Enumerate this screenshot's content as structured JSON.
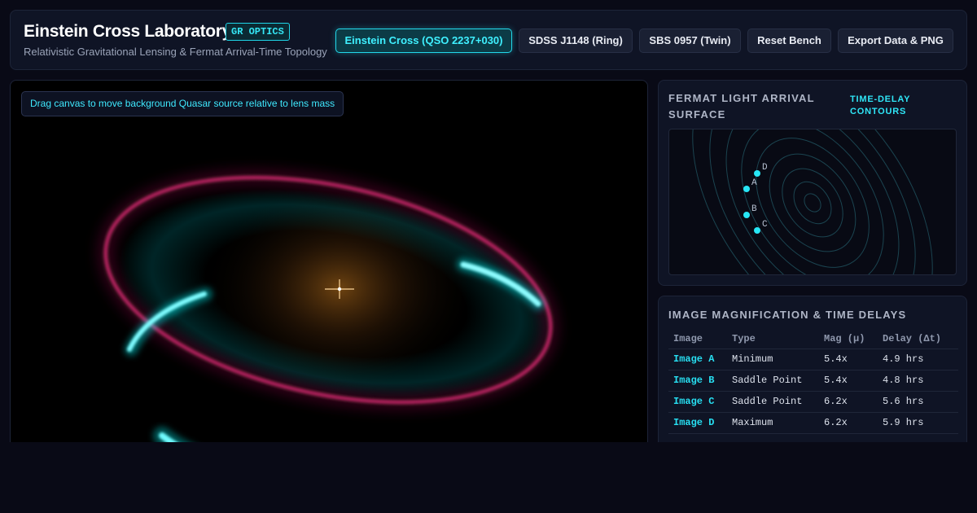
{
  "header": {
    "title": "Einstein Cross Laboratory",
    "badge": "GR OPTICS",
    "subtitle": "Relativistic Gravitational Lensing & Fermat Arrival-Time Topology"
  },
  "toolbar": {
    "buttons": [
      {
        "label": "Einstein Cross (QSO 2237+030)",
        "active": true
      },
      {
        "label": "SDSS J1148 (Ring)",
        "active": false
      },
      {
        "label": "SBS 0957 (Twin)",
        "active": false
      },
      {
        "label": "Reset Bench",
        "active": false
      },
      {
        "label": "Export Data & PNG",
        "active": false
      }
    ]
  },
  "canvas": {
    "hint": "Drag canvas to move background Quasar source relative to lens mass"
  },
  "fermat": {
    "title": "Fermat Light Arrival Surface",
    "tag": "Time-Delay Contours",
    "images": [
      {
        "label": "D"
      },
      {
        "label": "A"
      },
      {
        "label": "B"
      },
      {
        "label": "C"
      }
    ]
  },
  "table": {
    "title": "Image Magnification & Time Delays",
    "headers": [
      "Image",
      "Type",
      "Mag (μ)",
      "Delay (Δt)"
    ],
    "rows": [
      {
        "image": "Image A",
        "type": "Minimum",
        "mag": "5.4x",
        "delay": "4.9 hrs"
      },
      {
        "image": "Image B",
        "type": "Saddle Point",
        "mag": "5.4x",
        "delay": "4.8 hrs"
      },
      {
        "image": "Image C",
        "type": "Saddle Point",
        "mag": "6.2x",
        "delay": "5.6 hrs"
      },
      {
        "image": "Image D",
        "type": "Maximum",
        "mag": "6.2x",
        "delay": "5.9 hrs"
      }
    ]
  },
  "colors": {
    "accent": "#23d8ea",
    "ring_cyan": "#00ffff",
    "ring_magenta": "#c81e64",
    "lens_glow": "#c87a1e",
    "panel_bg": "#0f1425",
    "page_bg": "#090a16"
  }
}
